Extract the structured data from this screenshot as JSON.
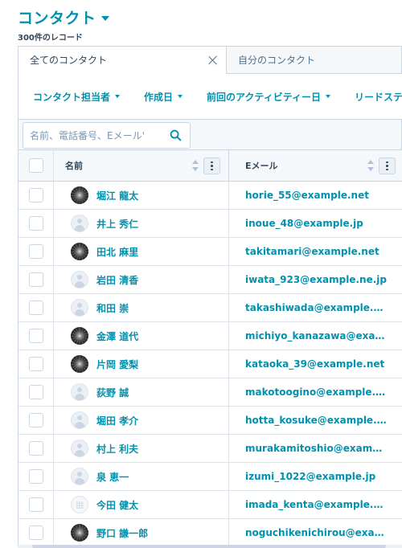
{
  "header": {
    "title": "コンタクト",
    "record_count": "300件のレコード"
  },
  "tabs": [
    {
      "label": "全てのコンタクト",
      "active": true
    },
    {
      "label": "自分のコンタクト",
      "active": false
    }
  ],
  "filters": [
    {
      "label": "コンタクト担当者"
    },
    {
      "label": "作成日"
    },
    {
      "label": "前回のアクティビティー日"
    },
    {
      "label": "リードステ"
    }
  ],
  "search": {
    "placeholder": "名前、電話番号、Eメール'",
    "icon": "search-icon"
  },
  "table": {
    "columns": [
      {
        "label": "名前"
      },
      {
        "label": "Eメール"
      }
    ],
    "rows": [
      {
        "name": "堀江 龍太",
        "email": "horie_55@example.net",
        "avatar": "photo"
      },
      {
        "name": "井上 秀仁",
        "email": "inoue_48@example.jp",
        "avatar": "default"
      },
      {
        "name": "田北 麻里",
        "email": "takitamari@example.net",
        "avatar": "photo"
      },
      {
        "name": "岩田 清香",
        "email": "iwata_923@example.ne.jp",
        "avatar": "default"
      },
      {
        "name": "和田 崇",
        "email": "takashiwada@example.ne.jp",
        "avatar": "default"
      },
      {
        "name": "金澤 道代",
        "email": "michiyo_kanazawa@exam...",
        "avatar": "photo"
      },
      {
        "name": "片岡 愛梨",
        "email": "kataoka_39@example.net",
        "avatar": "photo"
      },
      {
        "name": "荻野 誠",
        "email": "makotoogino@example.com",
        "avatar": "default"
      },
      {
        "name": "堀田 孝介",
        "email": "hotta_kosuke@example.co...",
        "avatar": "default"
      },
      {
        "name": "村上 利夫",
        "email": "murakamitoshio@example....",
        "avatar": "default"
      },
      {
        "name": "泉 恵一",
        "email": "izumi_1022@example.jp",
        "avatar": "default"
      },
      {
        "name": "今田 健太",
        "email": "imada_kenta@example.org",
        "avatar": "company"
      },
      {
        "name": "野口 謙一郎",
        "email": "noguchikenichirou@examp...",
        "avatar": "photo"
      }
    ]
  },
  "colors": {
    "accent": "#0091ae",
    "text": "#33475b",
    "border": "#cbd6e2",
    "header_bg": "#f5f8fa"
  }
}
